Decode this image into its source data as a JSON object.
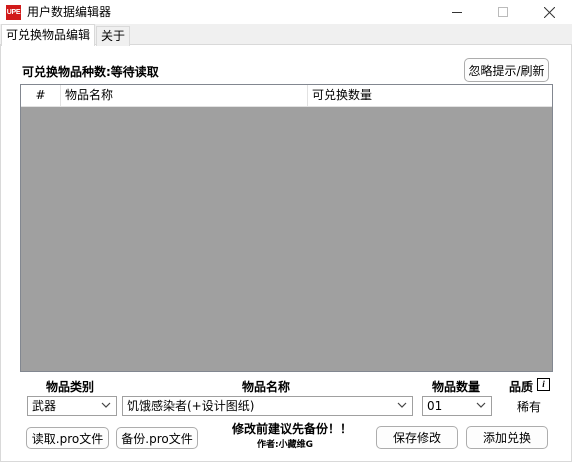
{
  "window": {
    "app_icon_text": "UPE",
    "title": "用户数据编辑器",
    "controls": {
      "minimize_icon": "minimize-icon",
      "maximize_icon": "maximize-icon",
      "close_icon": "close-icon"
    }
  },
  "tabs": [
    {
      "label": "可兑换物品编辑",
      "active": true
    },
    {
      "label": "关于",
      "active": false
    }
  ],
  "main": {
    "item_count_text": "可兑换物品种数:等待读取",
    "refresh_button": "忽略提示/刷新",
    "table": {
      "columns": [
        "#",
        "物品名称",
        "可兑换数量"
      ],
      "rows": []
    }
  },
  "form": {
    "category": {
      "label": "物品类别",
      "value": "武器"
    },
    "name": {
      "label": "物品名称",
      "value": "饥饿感染者(+设计图纸)"
    },
    "quantity": {
      "label": "物品数量",
      "value": "01"
    },
    "quality": {
      "label": "品质",
      "info_icon_text": "i",
      "value": "稀有"
    }
  },
  "actions": {
    "read_button": "读取.pro文件",
    "backup_button": "备份.pro文件",
    "warning": "修改前建议先备份！！",
    "author": "作者:小藏维G",
    "save_button": "保存修改",
    "add_button": "添加兑换"
  },
  "colors": {
    "grid_background": "#a0a0a0",
    "app_icon_background": "#d11a1a"
  }
}
